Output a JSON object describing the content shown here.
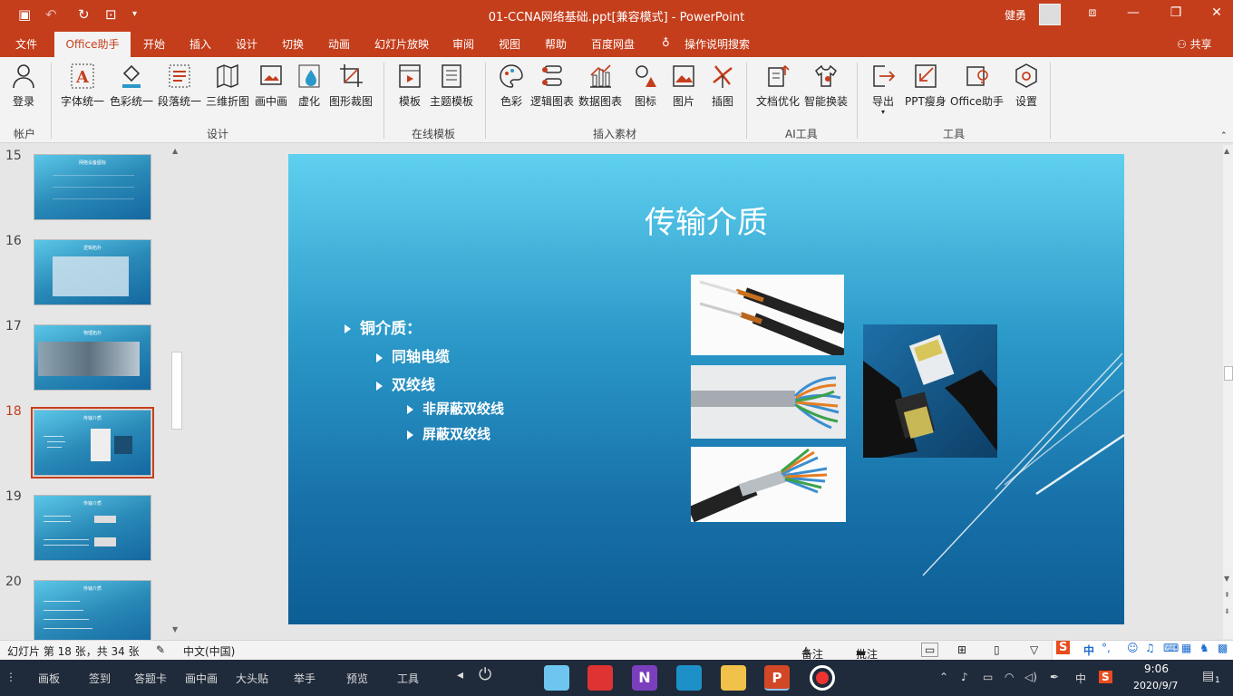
{
  "window": {
    "title": "01-CCNA网络基础.ppt[兼容模式]  -  PowerPoint",
    "user": "健勇"
  },
  "tabs": [
    "文件",
    "Office助手",
    "开始",
    "插入",
    "设计",
    "切换",
    "动画",
    "幻灯片放映",
    "审阅",
    "视图",
    "帮助",
    "百度网盘",
    "操作说明搜索",
    "共享"
  ],
  "ribbon": {
    "account": {
      "login": "登录",
      "group": "帐户"
    },
    "design": {
      "items": [
        "字体统一",
        "色彩统一",
        "段落统一",
        "三维折图",
        "画中画",
        "虚化",
        "图形裁图"
      ],
      "group": "设计"
    },
    "online": {
      "items": [
        "模板",
        "主题模板"
      ],
      "group": "在线模板"
    },
    "insert": {
      "items": [
        "色彩",
        "逻辑图表",
        "数据图表",
        "图标",
        "图片",
        "插图"
      ],
      "group": "插入素材"
    },
    "ai": {
      "items": [
        "文档优化",
        "智能换装"
      ],
      "group": "AI工具"
    },
    "tools": {
      "items": [
        "导出",
        "PPT瘦身",
        "Office助手",
        "设置"
      ],
      "group": "工具"
    }
  },
  "thumbnails": [
    {
      "num": "15",
      "title": "网络设备图标"
    },
    {
      "num": "16",
      "title": "逻辑拓扑"
    },
    {
      "num": "17",
      "title": "物理拓扑"
    },
    {
      "num": "18",
      "title": "传输介质"
    },
    {
      "num": "19",
      "title": "传输介质"
    },
    {
      "num": "20",
      "title": "传输介质"
    }
  ],
  "slide": {
    "title": "传输介质",
    "bullets": [
      {
        "level": 1,
        "text": "铜介质："
      },
      {
        "level": 2,
        "text": "同轴电缆"
      },
      {
        "level": 2,
        "text": "双绞线"
      },
      {
        "level": 3,
        "text": "非屏蔽双绞线"
      },
      {
        "level": 3,
        "text": "屏蔽双绞线"
      }
    ]
  },
  "status": {
    "slide_info": "幻灯片 第 18 张，共 34 张",
    "language": "中文(中国)",
    "notes": "备注",
    "comments": "批注"
  },
  "taskbar": {
    "items": [
      "画板",
      "签到",
      "答题卡",
      "画中画",
      "大头贴",
      "举手",
      "预览",
      "工具"
    ],
    "ime": "中",
    "time": "9:06",
    "date": "2020/9/7",
    "notif_count": "1"
  },
  "colors": {
    "accent": "#c43e1c",
    "slide_top": "#5fd0ef",
    "slide_bottom": "#0d5e95"
  }
}
